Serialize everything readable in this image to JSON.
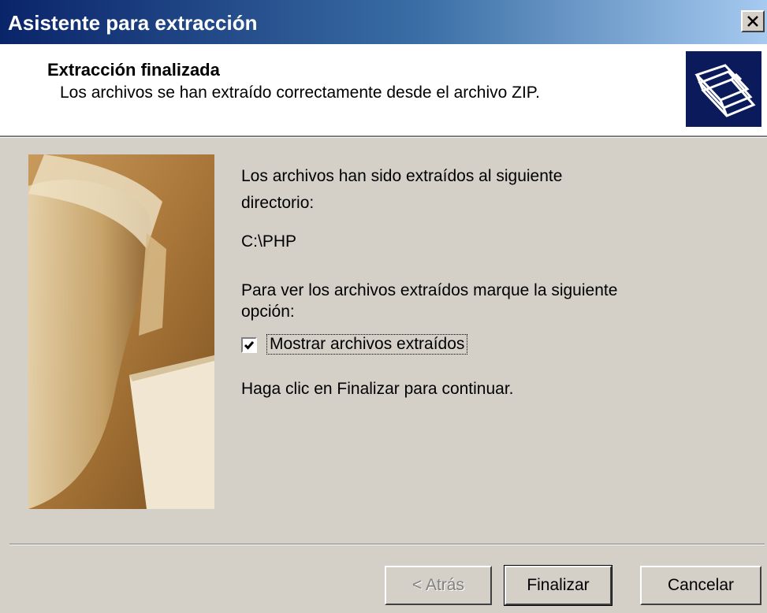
{
  "window": {
    "title": "Asistente para extracción",
    "close_label": "×"
  },
  "header": {
    "title": "Extracción finalizada",
    "subtitle": "Los archivos se han extraído correctamente desde el archivo ZIP.",
    "icon": "folders-icon"
  },
  "content": {
    "line1": "Los archivos han sido extraídos al siguiente",
    "line2": "directorio:",
    "path": "C:\\PHP",
    "hint1": "Para ver los archivos extraídos marque la siguiente",
    "hint2": "opción:",
    "checkbox_label": "Mostrar archivos extraídos",
    "checkbox_checked": true,
    "checkmark": "✔",
    "continue_text": "Haga clic en Finalizar para continuar."
  },
  "buttons": {
    "back": "< Atrás",
    "finish": "Finalizar",
    "cancel": "Cancelar"
  },
  "colors": {
    "titlebar_start": "#0a246a",
    "titlebar_end": "#a6caf0",
    "dialog_bg": "#d4d0c8"
  }
}
